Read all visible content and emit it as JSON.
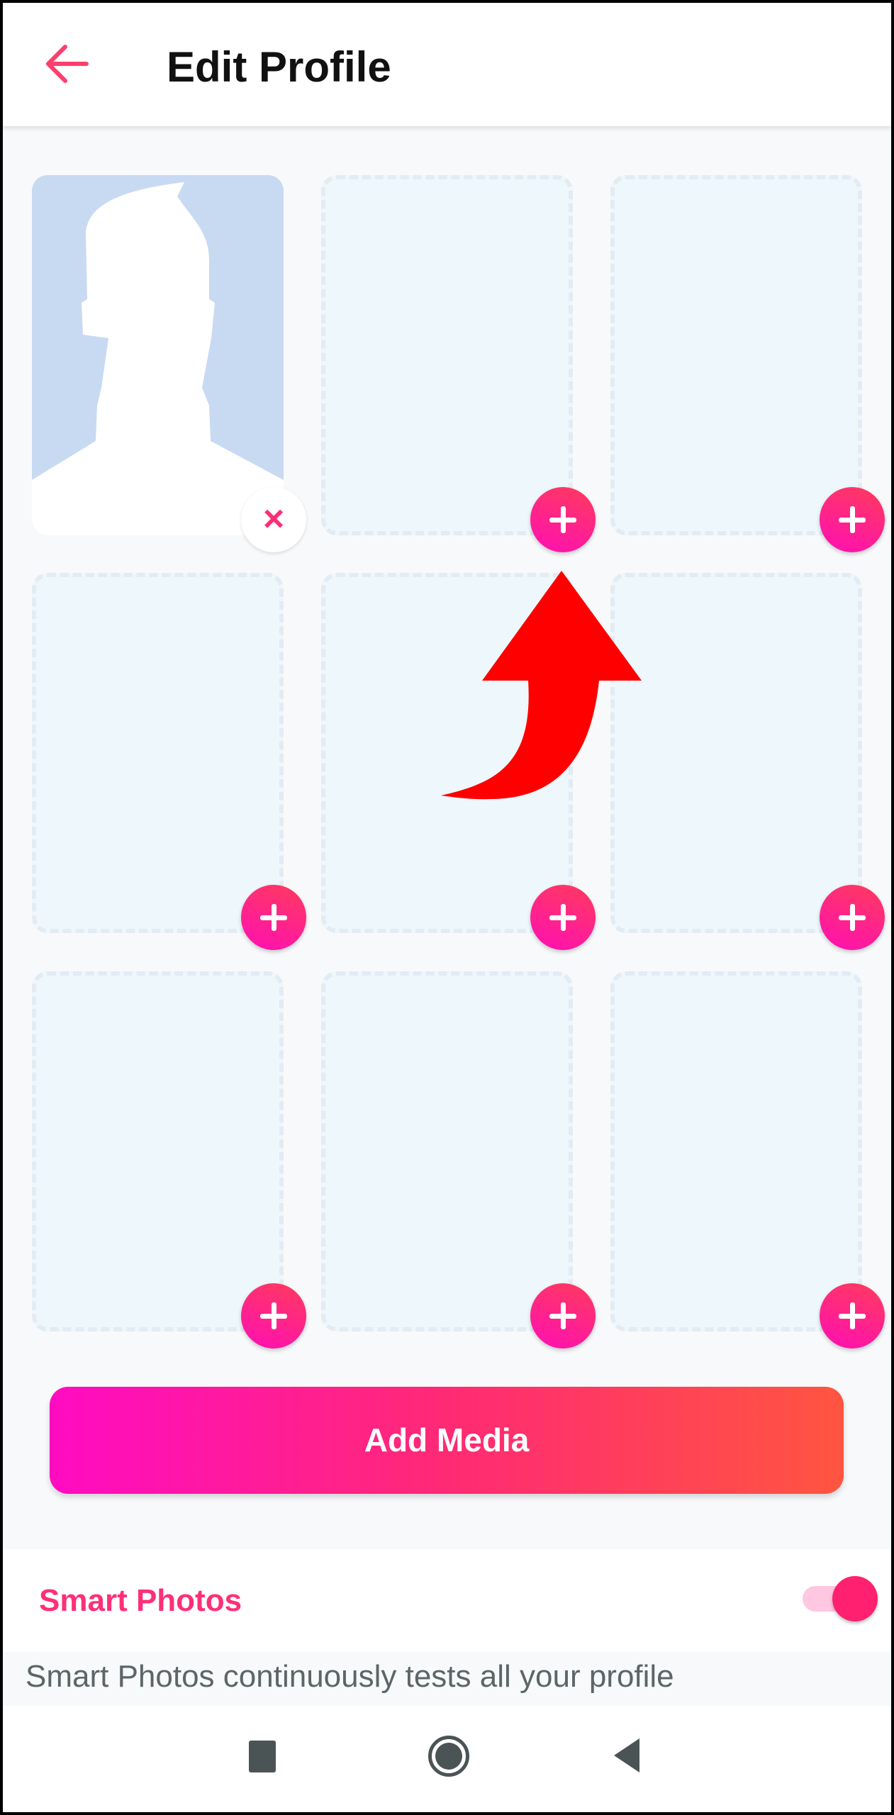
{
  "header": {
    "title": "Edit Profile",
    "back_icon": "arrow-left-icon"
  },
  "photo_grid": {
    "slots": [
      {
        "filled": true,
        "action_icon": "close-icon",
        "action_label": "×"
      },
      {
        "filled": false,
        "action_icon": "plus-icon"
      },
      {
        "filled": false,
        "action_icon": "plus-icon"
      },
      {
        "filled": false,
        "action_icon": "plus-icon"
      },
      {
        "filled": false,
        "action_icon": "plus-icon"
      },
      {
        "filled": false,
        "action_icon": "plus-icon"
      },
      {
        "filled": false,
        "action_icon": "plus-icon"
      },
      {
        "filled": false,
        "action_icon": "plus-icon"
      },
      {
        "filled": false,
        "action_icon": "plus-icon"
      }
    ]
  },
  "add_media_label": "Add Media",
  "smart_photos": {
    "label": "Smart Photos",
    "enabled": true,
    "description": "Smart Photos continuously tests all your profile"
  },
  "annotation": {
    "icon": "red-curved-arrow-icon",
    "color": "#ff0000"
  },
  "colors": {
    "accent": "#fe2f78",
    "gradient_start": "#ff0bc3",
    "gradient_end": "#ff5540"
  },
  "nav_bar": {
    "icons": [
      "recents-square-icon",
      "home-circle-icon",
      "back-triangle-icon"
    ]
  }
}
